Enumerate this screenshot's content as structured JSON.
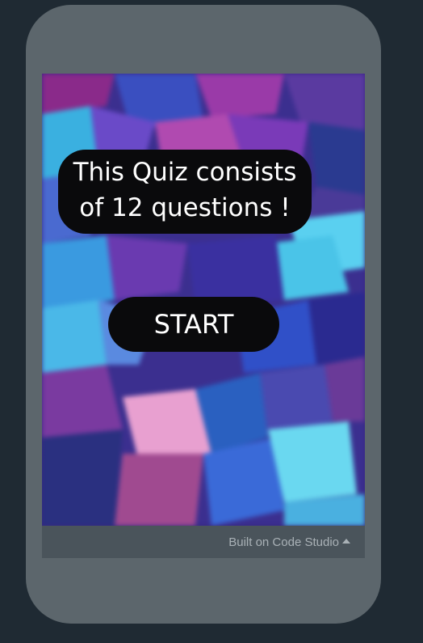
{
  "app": {
    "quiz_info": "This Quiz consists of 12 questions !",
    "start_label": "START"
  },
  "footer": {
    "built_on_label": "Built on Code Studio",
    "caret_icon": "caret-up-icon"
  },
  "colors": {
    "page_background": "#1f2a33",
    "phone_frame": "#5c666c",
    "footer_bar": "#4a545b",
    "pill_background": "#0a0a0c",
    "pill_text": "#ffffff",
    "footer_text": "#a9b1b6"
  }
}
